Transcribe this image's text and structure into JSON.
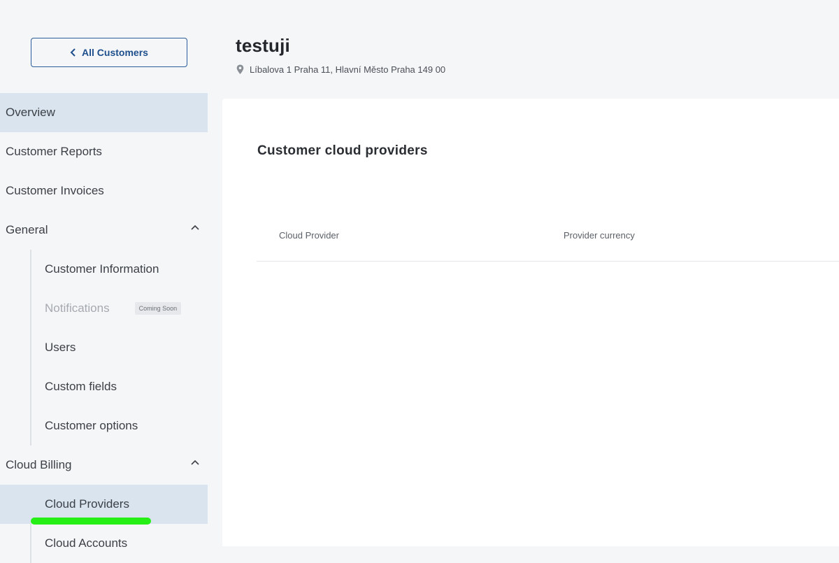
{
  "back_button": {
    "label": "All Customers",
    "icon": "chevron-left-icon"
  },
  "header": {
    "title": "testuji",
    "address": "Líbalova 1 Praha 11, Hlavní Město Praha 149 00",
    "address_icon": "map-pin-icon"
  },
  "sidebar": {
    "overview": "Overview",
    "customer_reports": "Customer Reports",
    "customer_invoices": "Customer Invoices",
    "general": {
      "label": "General",
      "items": {
        "customer_information": "Customer Information",
        "notifications": "Notifications",
        "notifications_badge": "Coming Soon",
        "users": "Users",
        "custom_fields": "Custom fields",
        "customer_options": "Customer options"
      }
    },
    "cloud_billing": {
      "label": "Cloud Billing",
      "items": {
        "cloud_providers": "Cloud Providers",
        "cloud_accounts": "Cloud Accounts"
      }
    }
  },
  "main": {
    "heading": "Customer cloud providers",
    "columns": [
      "Cloud Provider",
      "Provider currency"
    ]
  },
  "colors": {
    "accent": "#1e4f8c",
    "active_bg": "#d9e4ef",
    "highlight": "#26ef16"
  }
}
